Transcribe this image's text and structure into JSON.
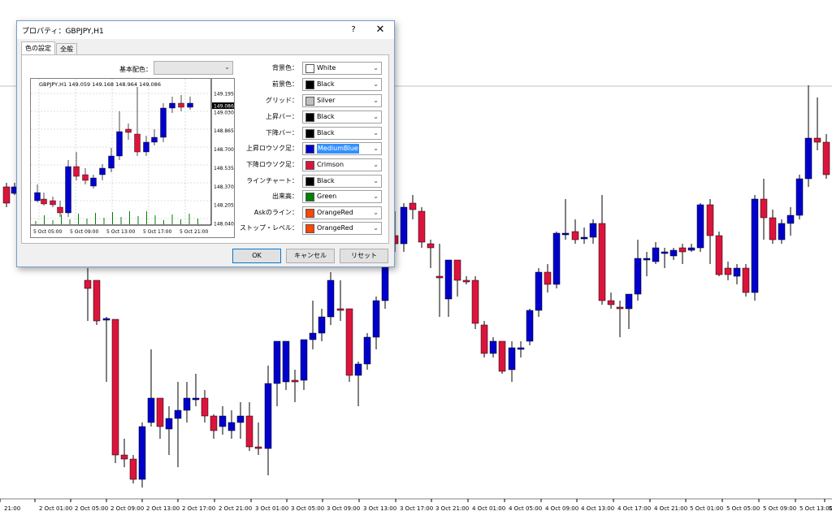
{
  "dialog": {
    "title": "プロパティ：GBPJPY,H1",
    "help_label": "?",
    "close_label": "✕",
    "tabs": [
      {
        "label": "色の設定",
        "active": true
      },
      {
        "label": "全般",
        "active": false
      }
    ],
    "scheme_label": "基本配色：",
    "scheme_value": "",
    "color_rows": [
      {
        "label": "背景色：",
        "value": "White",
        "color": "#ffffff"
      },
      {
        "label": "前景色：",
        "value": "Black",
        "color": "#000000"
      },
      {
        "label": "グリッド：",
        "value": "Silver",
        "color": "#c0c0c0"
      },
      {
        "label": "上昇バー：",
        "value": "Black",
        "color": "#000000"
      },
      {
        "label": "下降バー：",
        "value": "Black",
        "color": "#000000"
      },
      {
        "label": "上昇ロウソク足：",
        "value": "MediumBlue",
        "color": "#0000cd",
        "selected": true
      },
      {
        "label": "下降ロウソク足：",
        "value": "Crimson",
        "color": "#dc143c"
      },
      {
        "label": "ラインチャート：",
        "value": "Black",
        "color": "#000000"
      },
      {
        "label": "出来高：",
        "value": "Green",
        "color": "#008000"
      },
      {
        "label": "Askのライン：",
        "value": "OrangeRed",
        "color": "#ff4500"
      },
      {
        "label": "ストップ・レベル：",
        "value": "OrangeRed",
        "color": "#ff4500"
      }
    ],
    "buttons": {
      "ok": "OK",
      "cancel": "キャンセル",
      "reset": "リセット"
    },
    "preview": {
      "header": "GBPJPY,H1  149.059 149.168 148.964 149.086",
      "price_labels": [
        "149.195",
        "149.086",
        "149.030",
        "148.865",
        "148.700",
        "148.535",
        "148.370",
        "148.205",
        "148.040"
      ],
      "highlight_price": "149.086",
      "time_labels": [
        "5 Oct 05:00",
        "5 Oct 09:00",
        "5 Oct 13:00",
        "5 Oct 17:00",
        "5 Oct 21:00"
      ]
    }
  },
  "main_chart": {
    "time_labels": [
      "21:00",
      "2 Oct 01:00",
      "2 Oct 05:00",
      "2 Oct 09:00",
      "2 Oct 13:00",
      "2 Oct 17:00",
      "2 Oct 21:00",
      "3 Oct 01:00",
      "3 Oct 05:00",
      "3 Oct 09:00",
      "3 Oct 13:00",
      "3 Oct 17:00",
      "3 Oct 21:00",
      "4 Oct 01:00",
      "4 Oct 05:00",
      "4 Oct 09:00",
      "4 Oct 13:00",
      "4 Oct 17:00",
      "4 Oct 21:00",
      "5 Oct 01:00",
      "5 Oct 05:00",
      "5 Oct 09:00",
      "5 Oct 13:00",
      "5"
    ],
    "up_color": "#0000cd",
    "down_color": "#dc143c"
  }
}
